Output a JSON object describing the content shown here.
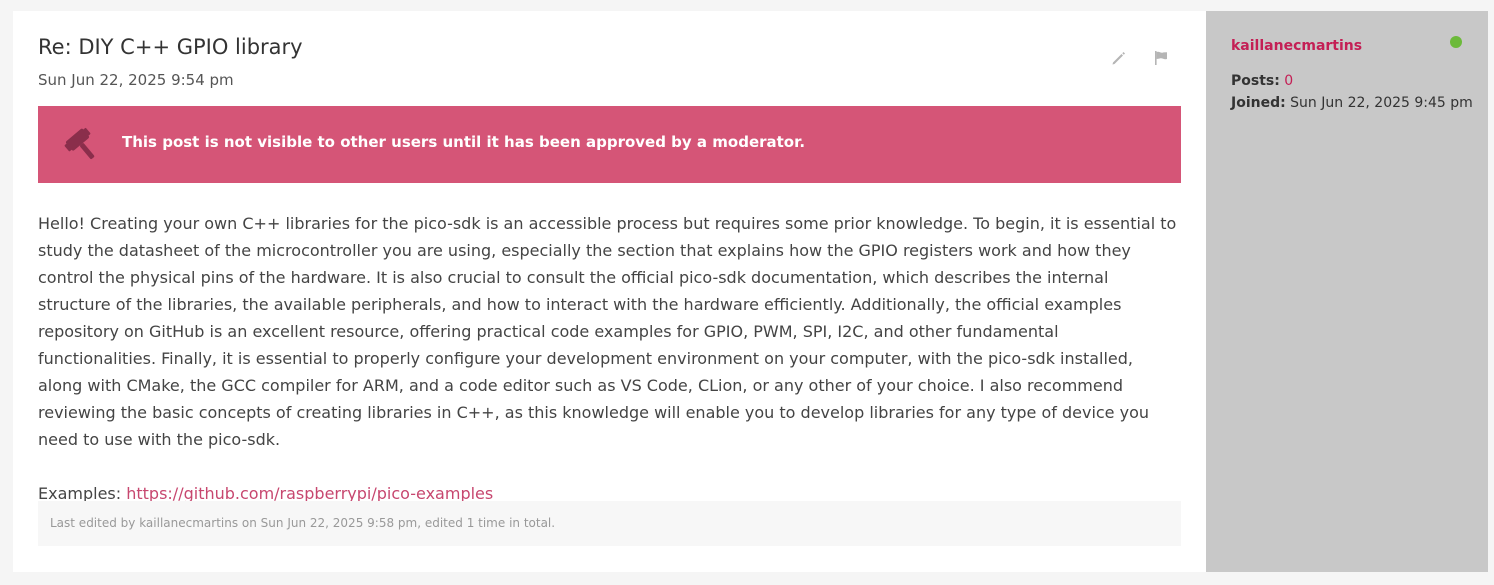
{
  "post": {
    "title": "Re: DIY C++ GPIO library",
    "date": "Sun Jun 22, 2025 9:54 pm",
    "actions": {
      "edit_icon": "pencil-icon",
      "report_icon": "flag-icon"
    },
    "moderation_notice": {
      "icon": "gavel-icon",
      "text": "This post is not visible to other users until it has been approved by a moderator."
    },
    "body_paragraph": "Hello! Creating your own C++ libraries for the pico-sdk is an accessible process but requires some prior knowledge. To begin, it is essential to study the datasheet of the microcontroller you are using, especially the section that explains how the GPIO registers work and how they control the physical pins of the hardware. It is also crucial to consult the official pico-sdk documentation, which describes the internal structure of the libraries, the available peripherals, and how to interact with the hardware efficiently. Additionally, the official examples repository on GitHub is an excellent resource, offering practical code examples for GPIO, PWM, SPI, I2C, and other fundamental functionalities. Finally, it is essential to properly configure your development environment on your computer, with the pico-sdk installed, along with CMake, the GCC compiler for ARM, and a code editor such as VS Code, CLion, or any other of your choice. I also recommend reviewing the basic concepts of creating libraries in C++, as this knowledge will enable you to develop libraries for any type of device you need to use with the pico-sdk.",
    "examples_label": "Examples:",
    "examples_link": "https://github.com/raspberrypi/pico-examples",
    "edit_notice": "Last edited by kaillanecmartins on Sun Jun 22, 2025 9:58 pm, edited 1 time in total."
  },
  "profile": {
    "username": "kaillanecmartins",
    "online_status_color": "#6cba3a",
    "posts_label": "Posts:",
    "posts_value": "0",
    "joined_label": "Joined:",
    "joined_value": "Sun Jun 22, 2025 9:45 pm"
  },
  "colors": {
    "accent": "#c41f55",
    "notice_bg": "#d55577",
    "sidebar_bg": "#c8c8c8"
  }
}
